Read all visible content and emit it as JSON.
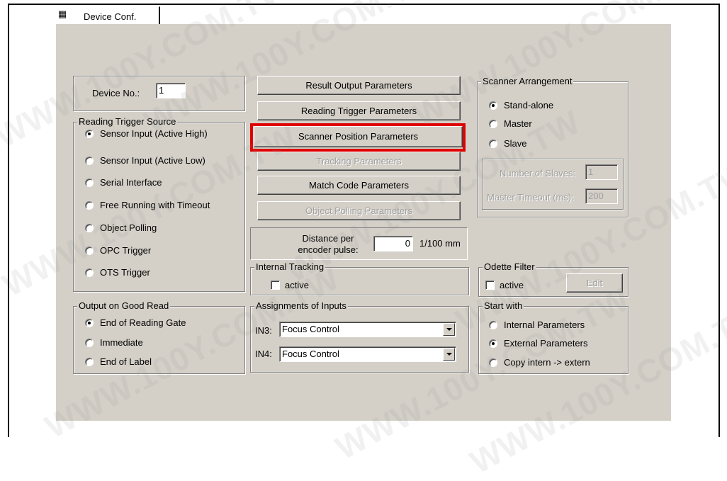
{
  "tab": {
    "label": "Device Conf.",
    "icon": "settings-grid-icon"
  },
  "device": {
    "label": "Device No.:",
    "value": "1"
  },
  "reading_trigger": {
    "title": "Reading Trigger Source",
    "options": [
      {
        "label": "Sensor Input (Active High)",
        "selected": true
      },
      {
        "label": "Sensor Input (Active Low)",
        "selected": false
      },
      {
        "label": "Serial Interface",
        "selected": false
      },
      {
        "label": "Free Running with Timeout",
        "selected": false
      },
      {
        "label": "Object Polling",
        "selected": false
      },
      {
        "label": "OPC Trigger",
        "selected": false
      },
      {
        "label": "OTS Trigger",
        "selected": false
      }
    ]
  },
  "output_good_read": {
    "title": "Output on Good Read",
    "options": [
      {
        "label": "End of Reading Gate",
        "selected": true
      },
      {
        "label": "Immediate",
        "selected": false
      },
      {
        "label": "End of Label",
        "selected": false
      }
    ]
  },
  "buttons": {
    "result_output": "Result Output Parameters",
    "reading_trigger": "Reading Trigger Parameters",
    "scanner_position": "Scanner Position Parameters",
    "tracking": "Tracking Parameters",
    "match_code": "Match Code Parameters",
    "object_polling": "Object Polling Parameters"
  },
  "distance": {
    "label_line1": "Distance per",
    "label_line2": "encoder pulse:",
    "value": "0",
    "unit": "1/100 mm"
  },
  "internal_tracking": {
    "title": "Internal Tracking",
    "checkbox_label": "active",
    "checked": false
  },
  "assignments": {
    "title": "Assignments of Inputs",
    "in3": {
      "label": "IN3:",
      "value": "Focus Control"
    },
    "in4": {
      "label": "IN4:",
      "value": "Focus Control"
    }
  },
  "scanner_arrangement": {
    "title": "Scanner Arrangement",
    "options": [
      {
        "label": "Stand-alone",
        "selected": true
      },
      {
        "label": "Master",
        "selected": false
      },
      {
        "label": "Slave",
        "selected": false
      }
    ],
    "slaves_label": "Number of Slaves:",
    "slaves_value": "1",
    "timeout_label": "Master Timeout (ms):",
    "timeout_value": "200"
  },
  "odette": {
    "title": "Odette Filter",
    "checkbox_label": "active",
    "checked": false,
    "edit_label": "Edit"
  },
  "start_with": {
    "title": "Start with",
    "options": [
      {
        "label": "Internal Parameters",
        "selected": false
      },
      {
        "label": "External Parameters",
        "selected": true
      },
      {
        "label": "Copy intern -> extern",
        "selected": false
      }
    ]
  },
  "watermark": "WWW.100Y.COM.TW",
  "colors": {
    "panel": "#d4d0c8",
    "highlight": "#e00000",
    "disabled_text": "#a0a0a0"
  }
}
